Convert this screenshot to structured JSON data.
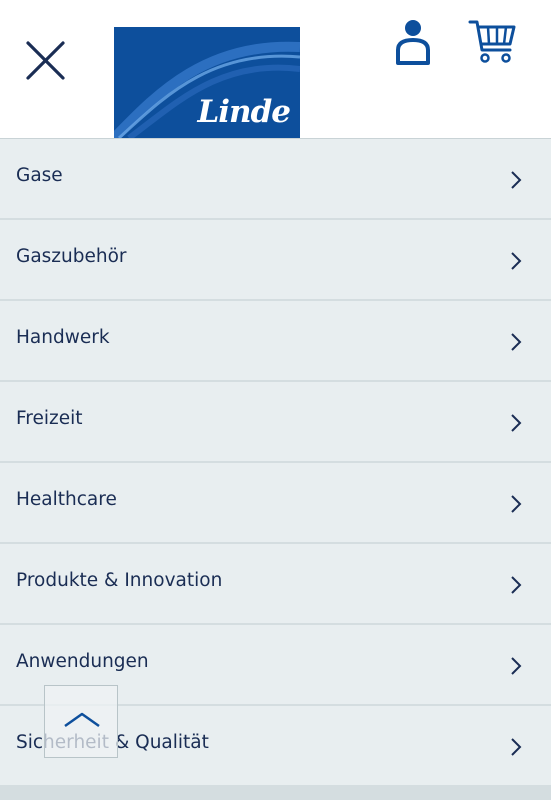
{
  "header": {
    "logo_text": "Linde",
    "close_icon": "close-icon",
    "account_icon": "user-icon",
    "cart_icon": "cart-icon"
  },
  "menu": {
    "items": [
      {
        "label": "Gase"
      },
      {
        "label": "Gaszubehör"
      },
      {
        "label": "Handwerk"
      },
      {
        "label": "Freizeit"
      },
      {
        "label": "Healthcare"
      },
      {
        "label": "Produkte & Innovation"
      },
      {
        "label": "Anwendungen"
      },
      {
        "label": "Sicherheit & Qualität"
      }
    ],
    "chevron_icon": "chevron-right-icon"
  },
  "scroll_top": {
    "icon": "chevron-up-icon"
  },
  "colors": {
    "brand_blue": "#0d4f9c",
    "text_navy": "#1a2d54",
    "menu_bg": "#e8eef0",
    "divider": "#d4dde0"
  }
}
